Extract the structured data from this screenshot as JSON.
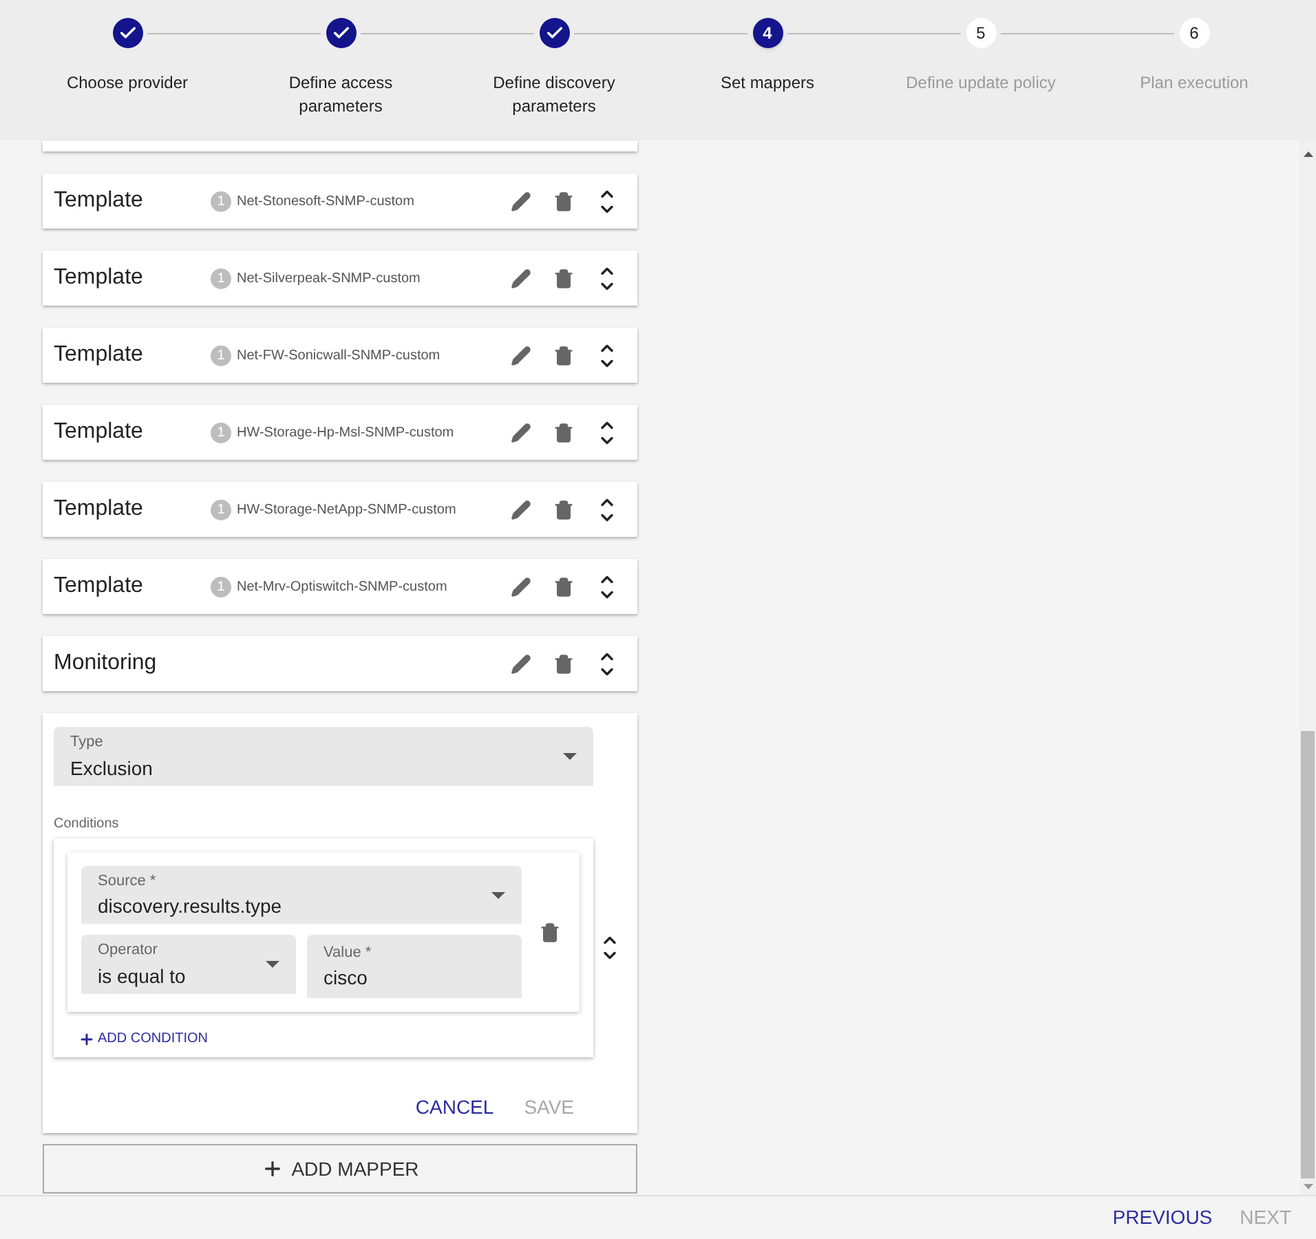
{
  "steps": [
    {
      "kind": "done",
      "label": "Choose provider"
    },
    {
      "kind": "done",
      "label": "Define access parameters"
    },
    {
      "kind": "done",
      "label": "Define discovery parameters"
    },
    {
      "kind": "active",
      "number": "4",
      "label": "Set mappers"
    },
    {
      "kind": "pending",
      "number": "5",
      "label": "Define update policy"
    },
    {
      "kind": "pending",
      "number": "6",
      "label": "Plan execution"
    }
  ],
  "mappers": [
    {
      "kind": "template",
      "title": "Template",
      "count": "1",
      "name": "Net-Stonesoft-SNMP-custom"
    },
    {
      "kind": "template",
      "title": "Template",
      "count": "1",
      "name": "Net-Silverpeak-SNMP-custom"
    },
    {
      "kind": "template",
      "title": "Template",
      "count": "1",
      "name": "Net-FW-Sonicwall-SNMP-custom"
    },
    {
      "kind": "template",
      "title": "Template",
      "count": "1",
      "name": "HW-Storage-Hp-Msl-SNMP-custom"
    },
    {
      "kind": "template",
      "title": "Template",
      "count": "1",
      "name": "HW-Storage-NetApp-SNMP-custom"
    },
    {
      "kind": "template",
      "title": "Template",
      "count": "1",
      "name": "Net-Mrv-Optiswitch-SNMP-custom"
    },
    {
      "kind": "monitoring",
      "title": "Monitoring"
    }
  ],
  "editor": {
    "type": {
      "label": "Type",
      "value": "Exclusion"
    },
    "conditions_label": "Conditions",
    "condition": {
      "source": {
        "label": "Source *",
        "value": "discovery.results.type"
      },
      "operator": {
        "label": "Operator",
        "value": "is equal to"
      },
      "value": {
        "label": "Value *",
        "value": "cisco"
      }
    },
    "add_condition": "ADD CONDITION",
    "cancel": "CANCEL",
    "save": {
      "label": "SAVE",
      "disabled": true
    }
  },
  "add_mapper": "ADD MAPPER",
  "footer": {
    "previous": {
      "label": "PREVIOUS",
      "disabled": false
    },
    "next": {
      "label": "NEXT",
      "disabled": true
    }
  }
}
